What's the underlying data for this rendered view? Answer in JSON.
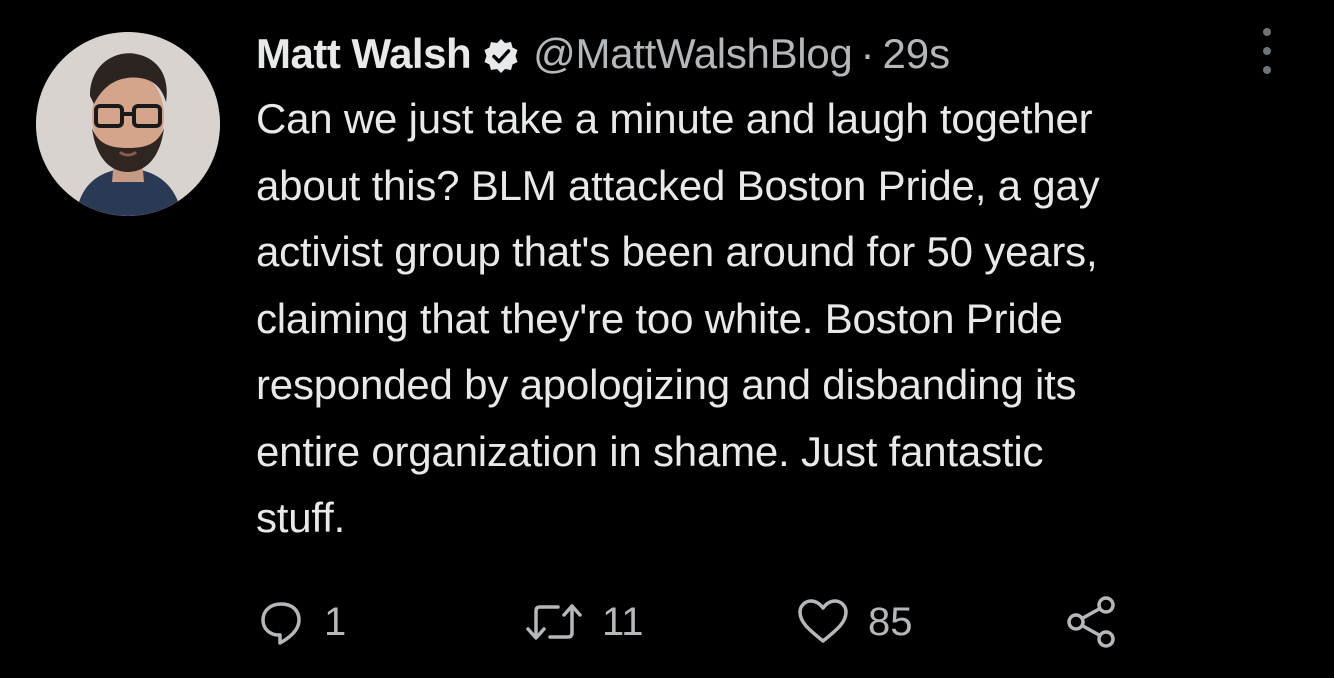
{
  "tweet": {
    "author": {
      "display_name": "Matt Walsh",
      "handle": "@MattWalshBlog",
      "verified": true,
      "avatar_icon": "profile-photo"
    },
    "separator": "·",
    "timestamp": "29s",
    "text": "Can we just take a minute and laugh together\nabout this? BLM attacked Boston Pride, a gay\nactivist group that's been around for 50 years,\nclaiming that they're too white. Boston Pride\nresponded by apologizing and disbanding its\nentire organization in shame. Just fantastic\nstuff.",
    "actions": {
      "reply_count": "1",
      "retweet_count": "11",
      "like_count": "85"
    }
  },
  "icons": {
    "verified": "verified-badge-icon",
    "more": "more-options-icon",
    "reply": "reply-icon",
    "retweet": "retweet-icon",
    "like": "heart-icon",
    "share": "share-icon"
  },
  "colors": {
    "background": "#000000",
    "primary_text": "#e7e9ea",
    "secondary_text": "#b5b8bb"
  }
}
